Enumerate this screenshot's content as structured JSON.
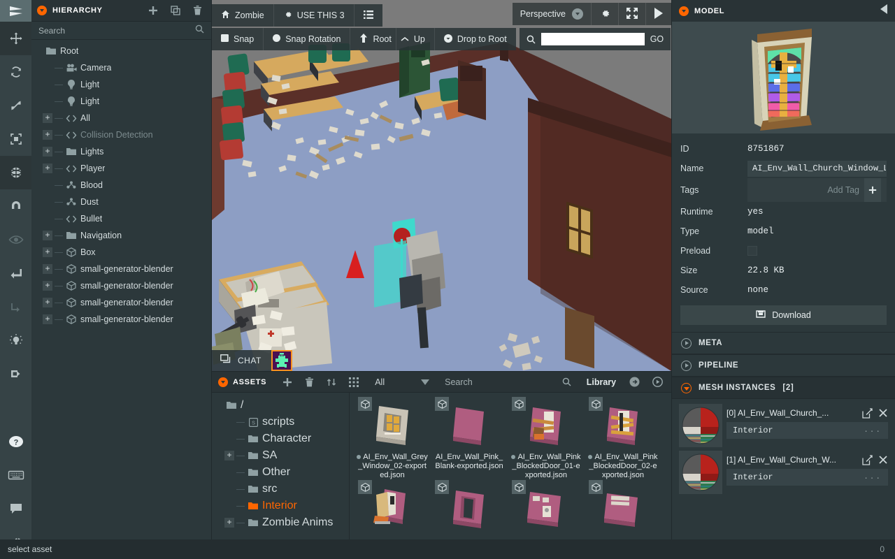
{
  "toolbar_rail": {
    "items": [
      {
        "name": "playcanvas-logo-icon",
        "state": "logo"
      },
      {
        "name": "translate-gizmo-icon",
        "state": "active-dark"
      },
      {
        "name": "rotate-gizmo-icon",
        "state": "normal"
      },
      {
        "name": "scale-gizmo-icon",
        "state": "normal"
      },
      {
        "name": "resize-gizmo-icon",
        "state": "normal"
      },
      {
        "name": "world-space-icon",
        "state": "active-dark"
      },
      {
        "name": "magnet-snap-icon",
        "state": "normal"
      },
      {
        "name": "visibility-eye-icon",
        "state": "dim"
      },
      {
        "name": "translate-to-parent-icon",
        "state": "normal"
      },
      {
        "name": "reparent-icon",
        "state": "dim"
      },
      {
        "name": "lightmap-bake-icon",
        "state": "normal"
      },
      {
        "name": "import-icon",
        "state": "normal"
      },
      {
        "name": "help-icon",
        "state": "normal"
      },
      {
        "name": "keyboard-shortcuts-icon",
        "state": "normal"
      },
      {
        "name": "chat-icon",
        "state": "normal"
      },
      {
        "name": "settings-gear-icon",
        "state": "normal"
      }
    ]
  },
  "hierarchy": {
    "title": "HIERARCHY",
    "add_label": "+",
    "search_placeholder": "Search",
    "tree": [
      {
        "label": "Root",
        "depth": 0,
        "icon": "folder",
        "expander": "none",
        "dim": false
      },
      {
        "label": "Camera",
        "depth": 1,
        "icon": "camera",
        "expander": "none",
        "dim": false
      },
      {
        "label": "Light",
        "depth": 1,
        "icon": "light",
        "expander": "none",
        "dim": false
      },
      {
        "label": "Light",
        "depth": 1,
        "icon": "light",
        "expander": "none",
        "dim": false
      },
      {
        "label": "All",
        "depth": 1,
        "icon": "script",
        "expander": "plus",
        "dim": false
      },
      {
        "label": "Collision Detection",
        "depth": 1,
        "icon": "script",
        "expander": "plus",
        "dim": true
      },
      {
        "label": "Lights",
        "depth": 1,
        "icon": "folder",
        "expander": "plus",
        "dim": false
      },
      {
        "label": "Player",
        "depth": 1,
        "icon": "script",
        "expander": "plus",
        "dim": false
      },
      {
        "label": "Blood",
        "depth": 1,
        "icon": "particle",
        "expander": "none",
        "dim": false
      },
      {
        "label": "Dust",
        "depth": 1,
        "icon": "particle",
        "expander": "none",
        "dim": false
      },
      {
        "label": "Bullet",
        "depth": 1,
        "icon": "script",
        "expander": "none",
        "dim": false
      },
      {
        "label": "Navigation",
        "depth": 1,
        "icon": "folder",
        "expander": "plus",
        "dim": false
      },
      {
        "label": "Box",
        "depth": 1,
        "icon": "model",
        "expander": "plus",
        "dim": false
      },
      {
        "label": "small-generator-blender",
        "depth": 1,
        "icon": "model",
        "expander": "plus",
        "dim": false
      },
      {
        "label": "small-generator-blender",
        "depth": 1,
        "icon": "model",
        "expander": "plus",
        "dim": false
      },
      {
        "label": "small-generator-blender",
        "depth": 1,
        "icon": "model",
        "expander": "plus",
        "dim": false
      },
      {
        "label": "small-generator-blender",
        "depth": 1,
        "icon": "model",
        "expander": "plus",
        "dim": false
      }
    ]
  },
  "viewport": {
    "top_left_group": [
      {
        "label": "Zombie",
        "icon": "home-icon"
      },
      {
        "label": "USE THIS 3",
        "icon": "gear-icon"
      },
      {
        "label": "",
        "icon": "list-icon"
      }
    ],
    "snap_group": [
      {
        "label": "Snap",
        "icon": "square-icon"
      },
      {
        "label": "Snap Rotation",
        "icon": "circle-icon"
      },
      {
        "label": "Root",
        "icon": "arrow-up-icon"
      },
      {
        "label": "Up",
        "icon": "chevron-up-icon"
      },
      {
        "label": "Drop to Root",
        "icon": "drop-icon"
      }
    ],
    "search": {
      "value": "",
      "go_label": "GO"
    },
    "camera_label": "Perspective",
    "top_right_icons": [
      "gear-icon",
      "fullscreen-icon",
      "play-icon"
    ],
    "chat_label": "CHAT"
  },
  "assets": {
    "title": "ASSETS",
    "filter_label": "All",
    "search_placeholder": "Search",
    "library_label": "Library",
    "tree": [
      {
        "label": "/",
        "depth": 0,
        "icon": "folder",
        "expander": "none",
        "selected": false
      },
      {
        "label": "scripts",
        "depth": 1,
        "icon": "script-folder",
        "expander": "none",
        "selected": false
      },
      {
        "label": "Character",
        "depth": 1,
        "icon": "folder",
        "expander": "none",
        "selected": false
      },
      {
        "label": "SA",
        "depth": 1,
        "icon": "folder",
        "expander": "plus",
        "selected": false
      },
      {
        "label": "Other",
        "depth": 1,
        "icon": "folder",
        "expander": "none",
        "selected": false
      },
      {
        "label": "src",
        "depth": 1,
        "icon": "folder",
        "expander": "none",
        "selected": false
      },
      {
        "label": "Interior",
        "depth": 1,
        "icon": "folder",
        "expander": "none",
        "selected": true
      },
      {
        "label": "Zombie Anims",
        "depth": 1,
        "icon": "folder",
        "expander": "plus",
        "selected": false
      }
    ],
    "grid": [
      {
        "label": "AI_Env_Wall_Grey_Window_02-exported.json",
        "thumb": "grey-window",
        "bullet": true
      },
      {
        "label": "AI_Env_Wall_Pink_Blank-exported.json",
        "thumb": "pink-blank",
        "bullet": false
      },
      {
        "label": "AI_Env_Wall_Pink_BlockedDoor_01-exported.json",
        "thumb": "pink-blocked-1",
        "bullet": true
      },
      {
        "label": "AI_Env_Wall_Pink_BlockedDoor_02-exported.json",
        "thumb": "pink-blocked-2",
        "bullet": true
      },
      {
        "label": "",
        "thumb": "pink-barricade",
        "bullet": false
      },
      {
        "label": "",
        "thumb": "pink-doorway",
        "bullet": false
      },
      {
        "label": "",
        "thumb": "pink-switch",
        "bullet": false
      },
      {
        "label": "",
        "thumb": "pink-plank",
        "bullet": false
      }
    ]
  },
  "inspector": {
    "title": "MODEL",
    "preview_icon": "stained-glass-window-thumbnail",
    "attributes": [
      {
        "label": "ID",
        "value": "8751867",
        "kind": "text"
      },
      {
        "label": "Name",
        "value": "AI_Env_Wall_Church_Window_Large-e",
        "kind": "input"
      },
      {
        "label": "Tags",
        "value": "Add Tag",
        "kind": "tags"
      },
      {
        "label": "Runtime",
        "value": "yes",
        "kind": "text"
      },
      {
        "label": "Type",
        "value": "model",
        "kind": "text"
      },
      {
        "label": "Preload",
        "value": "",
        "kind": "checkbox"
      },
      {
        "label": "Size",
        "value": "22.8 KB",
        "kind": "text"
      },
      {
        "label": "Source",
        "value": "none",
        "kind": "text"
      }
    ],
    "download_label": "Download",
    "sections": [
      {
        "label": "META",
        "open": false
      },
      {
        "label": "PIPELINE",
        "open": false
      }
    ],
    "mesh_section_label": "MESH INSTANCES",
    "mesh_section_count": "[2]",
    "mesh_instances": [
      {
        "name": "[0] AI_Env_Wall_Church_...",
        "material": "Interior",
        "dots": "..."
      },
      {
        "name": "[1] AI_Env_Wall_Church_W...",
        "material": "Interior",
        "dots": "..."
      }
    ]
  },
  "status_bar": {
    "left": "select asset",
    "right": "0"
  },
  "colors": {
    "accent": "#ff6600",
    "panel_bg": "#2c383b",
    "panel_head": "#293336",
    "rail_bg": "#364346",
    "text": "#e2e9ea"
  }
}
